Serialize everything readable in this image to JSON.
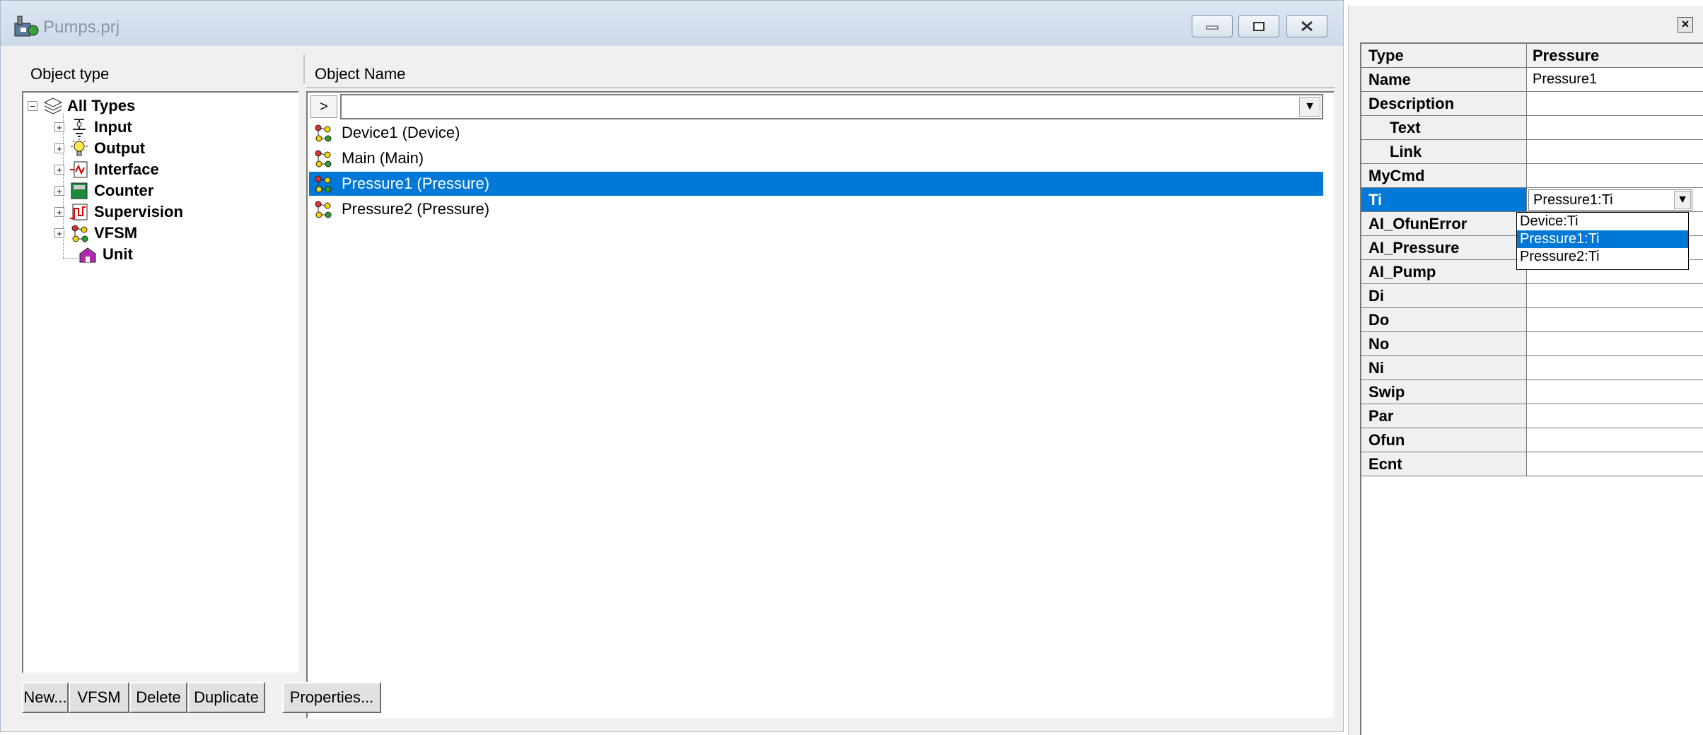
{
  "window": {
    "title": "Pumps.prj"
  },
  "columns": {
    "object_type": "Object type",
    "object_name": "Object Name"
  },
  "tree": {
    "root": "All Types",
    "items": [
      {
        "label": "Input",
        "icon": "input-icon"
      },
      {
        "label": "Output",
        "icon": "lightbulb-icon"
      },
      {
        "label": "Interface",
        "icon": "interface-icon"
      },
      {
        "label": "Counter",
        "icon": "counter-icon"
      },
      {
        "label": "Supervision",
        "icon": "supervision-icon"
      },
      {
        "label": "VFSM",
        "icon": "vfsm-icon"
      },
      {
        "label": "Unit",
        "icon": "unit-icon"
      }
    ]
  },
  "list": {
    "arrow_label": ">",
    "items": [
      {
        "label": "Device1 (Device)",
        "selected": false
      },
      {
        "label": "Main (Main)",
        "selected": false
      },
      {
        "label": "Pressure1 (Pressure)",
        "selected": true
      },
      {
        "label": "Pressure2 (Pressure)",
        "selected": false
      }
    ]
  },
  "buttons": {
    "new": "New...",
    "vfsm": "VFSM",
    "delete": "Delete",
    "duplicate": "Duplicate",
    "properties": "Properties..."
  },
  "properties": {
    "header": {
      "name": "Type",
      "value": "Pressure"
    },
    "rows": [
      {
        "name": "Name",
        "value": "Pressure1"
      },
      {
        "name": "Description",
        "value": ""
      },
      {
        "name": "Text",
        "value": ""
      },
      {
        "name": "Link",
        "value": ""
      },
      {
        "name": "MyCmd",
        "value": ""
      },
      {
        "name": "Ti",
        "value": "Pressure1:Ti"
      },
      {
        "name": "AI_OfunError",
        "value": ""
      },
      {
        "name": "AI_Pressure",
        "value": ""
      },
      {
        "name": "AI_Pump",
        "value": ""
      },
      {
        "name": "Di",
        "value": ""
      },
      {
        "name": "Do",
        "value": ""
      },
      {
        "name": "No",
        "value": ""
      },
      {
        "name": "Ni",
        "value": ""
      },
      {
        "name": "Swip",
        "value": ""
      },
      {
        "name": "Par",
        "value": ""
      },
      {
        "name": "Ofun",
        "value": ""
      },
      {
        "name": "Ecnt",
        "value": ""
      }
    ],
    "dropdown_options": [
      "Device:Ti",
      "Pressure1:Ti",
      "Pressure2:Ti"
    ]
  },
  "colors": {
    "selection": "#0078d7",
    "titlebar": "#dde6f2"
  }
}
